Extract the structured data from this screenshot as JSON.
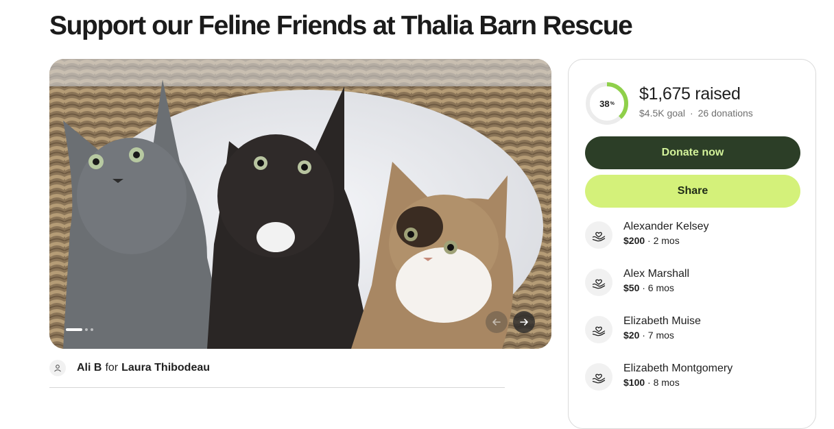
{
  "page": {
    "title": "Support our Feline Friends at Thalia Barn Rescue"
  },
  "hero": {
    "image_alt": "Three kittens sitting in a woven basket",
    "slide_count": 3,
    "active_slide": 1,
    "prev_icon": "arrow-left-icon",
    "next_icon": "arrow-right-icon"
  },
  "organizer": {
    "name": "Ali B",
    "connector": "for",
    "beneficiary": "Laura Thibodeau",
    "icon": "user-icon"
  },
  "donation": {
    "progress_percent": 38,
    "progress_label": "38",
    "progress_unit": "%",
    "raised": "$1,675 raised",
    "goal": "$4.5K goal",
    "separator": "·",
    "donations": "26 donations",
    "donate_label": "Donate now",
    "share_label": "Share"
  },
  "donors": [
    {
      "name": "Alexander Kelsey",
      "amount": "$200",
      "time": "· 2 mos"
    },
    {
      "name": "Alex Marshall",
      "amount": "$50",
      "time": "· 6 mos"
    },
    {
      "name": "Elizabeth Muise",
      "amount": "$20",
      "time": "· 7 mos"
    },
    {
      "name": "Elizabeth Montgomery",
      "amount": "$100",
      "time": "· 8 mos"
    }
  ],
  "colors": {
    "progress": "#8fd04a",
    "progress_track": "#ececec",
    "donate_bg": "#2c3e27",
    "donate_text": "#d3f29a",
    "share_bg": "#d4f17a"
  }
}
